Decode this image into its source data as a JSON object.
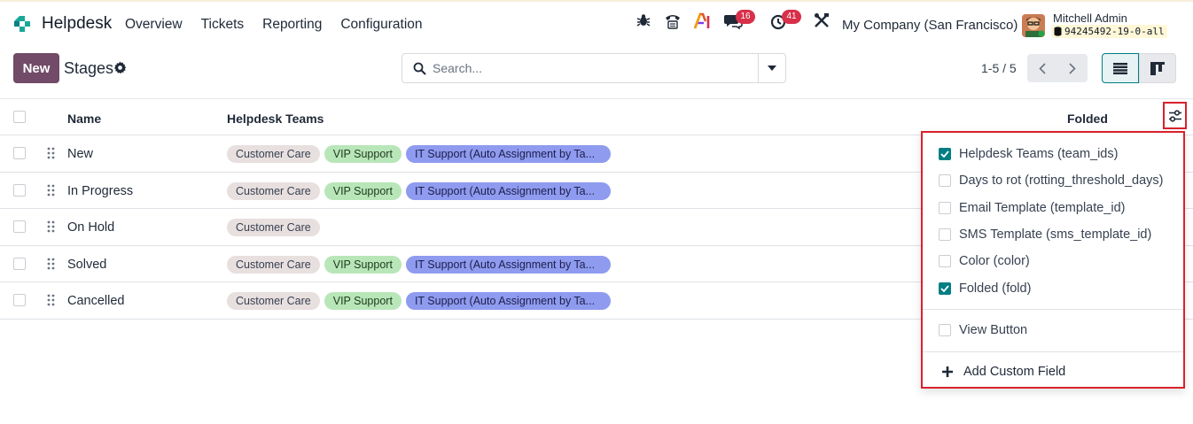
{
  "app": {
    "name": "Helpdesk",
    "menu": [
      "Overview",
      "Tickets",
      "Reporting",
      "Configuration"
    ]
  },
  "systray": {
    "messages_count": "16",
    "activities_count": "41",
    "company": "My Company (San Francisco)",
    "user_name": "Mitchell Admin",
    "database": "94245492-19-0-all"
  },
  "control_panel": {
    "new_label": "New",
    "title": "Stages",
    "search_placeholder": "Search...",
    "pager": "1-5 / 5"
  },
  "list": {
    "headers": {
      "name": "Name",
      "teams": "Helpdesk Teams",
      "folded": "Folded"
    },
    "rows": [
      {
        "name": "New",
        "teams": [
          "Customer Care",
          "VIP Support",
          "IT Support (Auto Assignment by Ta..."
        ]
      },
      {
        "name": "In Progress",
        "teams": [
          "Customer Care",
          "VIP Support",
          "IT Support (Auto Assignment by Ta..."
        ]
      },
      {
        "name": "On Hold",
        "teams": [
          "Customer Care"
        ]
      },
      {
        "name": "Solved",
        "teams": [
          "Customer Care",
          "VIP Support",
          "IT Support (Auto Assignment by Ta..."
        ]
      },
      {
        "name": "Cancelled",
        "teams": [
          "Customer Care",
          "VIP Support",
          "IT Support (Auto Assignment by Ta..."
        ]
      }
    ]
  },
  "optional_fields": {
    "items": [
      {
        "label": "Helpdesk Teams (team_ids)",
        "checked": true
      },
      {
        "label": "Days to rot (rotting_threshold_days)",
        "checked": false
      },
      {
        "label": "Email Template (template_id)",
        "checked": false
      },
      {
        "label": "SMS Template (sms_template_id)",
        "checked": false
      },
      {
        "label": "Color (color)",
        "checked": false
      },
      {
        "label": "Folded (fold)",
        "checked": true
      }
    ],
    "view_button_label": "View Button",
    "view_button_checked": false,
    "add_custom_field_label": "Add Custom Field"
  },
  "colors": {
    "primary": "#714b67",
    "accent": "#017e84",
    "highlight_border": "#d9212c",
    "badge": "#d9304a"
  }
}
